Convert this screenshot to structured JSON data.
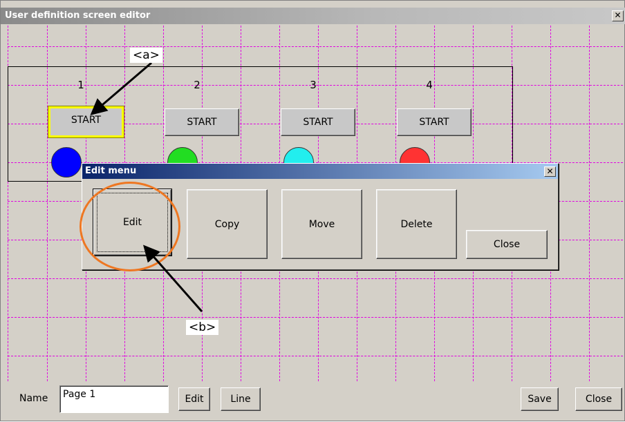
{
  "window": {
    "title": "User definition screen editor",
    "close_glyph": "✕"
  },
  "columns": [
    {
      "number": "1",
      "button_label": "START",
      "lamp_color": "#0000ff"
    },
    {
      "number": "2",
      "button_label": "START",
      "lamp_color": "#22dd22"
    },
    {
      "number": "3",
      "button_label": "START",
      "lamp_color": "#22eeee"
    },
    {
      "number": "4",
      "button_label": "START",
      "lamp_color": "#ff3333"
    }
  ],
  "edit_menu": {
    "title": "Edit menu",
    "close_glyph": "✕",
    "buttons": {
      "edit": "Edit",
      "copy": "Copy",
      "move": "Move",
      "delete": "Delete",
      "close": "Close"
    }
  },
  "annotations": {
    "a": "<a>",
    "b": "<b>",
    "ring_color": "#ee7722"
  },
  "bottom_bar": {
    "name_label": "Name",
    "name_value": "Page 1",
    "edit_label": "Edit",
    "line_label": "Line",
    "save_label": "Save",
    "close_label": "Close"
  },
  "colors": {
    "grid": "#e000e0",
    "highlight": "#ffff00",
    "dialog_title": "#0a246a"
  }
}
